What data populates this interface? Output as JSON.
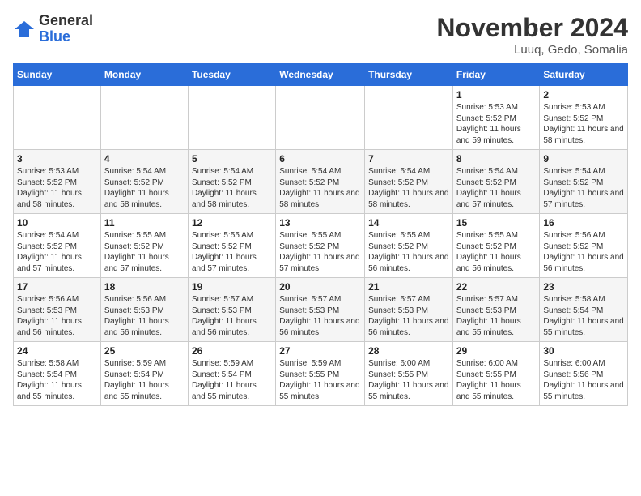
{
  "header": {
    "logo_line1": "General",
    "logo_line2": "Blue",
    "month_title": "November 2024",
    "location": "Luuq, Gedo, Somalia"
  },
  "days_of_week": [
    "Sunday",
    "Monday",
    "Tuesday",
    "Wednesday",
    "Thursday",
    "Friday",
    "Saturday"
  ],
  "weeks": [
    [
      {
        "day": "",
        "info": ""
      },
      {
        "day": "",
        "info": ""
      },
      {
        "day": "",
        "info": ""
      },
      {
        "day": "",
        "info": ""
      },
      {
        "day": "",
        "info": ""
      },
      {
        "day": "1",
        "info": "Sunrise: 5:53 AM\nSunset: 5:52 PM\nDaylight: 11 hours and 59 minutes."
      },
      {
        "day": "2",
        "info": "Sunrise: 5:53 AM\nSunset: 5:52 PM\nDaylight: 11 hours and 58 minutes."
      }
    ],
    [
      {
        "day": "3",
        "info": "Sunrise: 5:53 AM\nSunset: 5:52 PM\nDaylight: 11 hours and 58 minutes."
      },
      {
        "day": "4",
        "info": "Sunrise: 5:54 AM\nSunset: 5:52 PM\nDaylight: 11 hours and 58 minutes."
      },
      {
        "day": "5",
        "info": "Sunrise: 5:54 AM\nSunset: 5:52 PM\nDaylight: 11 hours and 58 minutes."
      },
      {
        "day": "6",
        "info": "Sunrise: 5:54 AM\nSunset: 5:52 PM\nDaylight: 11 hours and 58 minutes."
      },
      {
        "day": "7",
        "info": "Sunrise: 5:54 AM\nSunset: 5:52 PM\nDaylight: 11 hours and 58 minutes."
      },
      {
        "day": "8",
        "info": "Sunrise: 5:54 AM\nSunset: 5:52 PM\nDaylight: 11 hours and 57 minutes."
      },
      {
        "day": "9",
        "info": "Sunrise: 5:54 AM\nSunset: 5:52 PM\nDaylight: 11 hours and 57 minutes."
      }
    ],
    [
      {
        "day": "10",
        "info": "Sunrise: 5:54 AM\nSunset: 5:52 PM\nDaylight: 11 hours and 57 minutes."
      },
      {
        "day": "11",
        "info": "Sunrise: 5:55 AM\nSunset: 5:52 PM\nDaylight: 11 hours and 57 minutes."
      },
      {
        "day": "12",
        "info": "Sunrise: 5:55 AM\nSunset: 5:52 PM\nDaylight: 11 hours and 57 minutes."
      },
      {
        "day": "13",
        "info": "Sunrise: 5:55 AM\nSunset: 5:52 PM\nDaylight: 11 hours and 57 minutes."
      },
      {
        "day": "14",
        "info": "Sunrise: 5:55 AM\nSunset: 5:52 PM\nDaylight: 11 hours and 56 minutes."
      },
      {
        "day": "15",
        "info": "Sunrise: 5:55 AM\nSunset: 5:52 PM\nDaylight: 11 hours and 56 minutes."
      },
      {
        "day": "16",
        "info": "Sunrise: 5:56 AM\nSunset: 5:52 PM\nDaylight: 11 hours and 56 minutes."
      }
    ],
    [
      {
        "day": "17",
        "info": "Sunrise: 5:56 AM\nSunset: 5:53 PM\nDaylight: 11 hours and 56 minutes."
      },
      {
        "day": "18",
        "info": "Sunrise: 5:56 AM\nSunset: 5:53 PM\nDaylight: 11 hours and 56 minutes."
      },
      {
        "day": "19",
        "info": "Sunrise: 5:57 AM\nSunset: 5:53 PM\nDaylight: 11 hours and 56 minutes."
      },
      {
        "day": "20",
        "info": "Sunrise: 5:57 AM\nSunset: 5:53 PM\nDaylight: 11 hours and 56 minutes."
      },
      {
        "day": "21",
        "info": "Sunrise: 5:57 AM\nSunset: 5:53 PM\nDaylight: 11 hours and 56 minutes."
      },
      {
        "day": "22",
        "info": "Sunrise: 5:57 AM\nSunset: 5:53 PM\nDaylight: 11 hours and 55 minutes."
      },
      {
        "day": "23",
        "info": "Sunrise: 5:58 AM\nSunset: 5:54 PM\nDaylight: 11 hours and 55 minutes."
      }
    ],
    [
      {
        "day": "24",
        "info": "Sunrise: 5:58 AM\nSunset: 5:54 PM\nDaylight: 11 hours and 55 minutes."
      },
      {
        "day": "25",
        "info": "Sunrise: 5:59 AM\nSunset: 5:54 PM\nDaylight: 11 hours and 55 minutes."
      },
      {
        "day": "26",
        "info": "Sunrise: 5:59 AM\nSunset: 5:54 PM\nDaylight: 11 hours and 55 minutes."
      },
      {
        "day": "27",
        "info": "Sunrise: 5:59 AM\nSunset: 5:55 PM\nDaylight: 11 hours and 55 minutes."
      },
      {
        "day": "28",
        "info": "Sunrise: 6:00 AM\nSunset: 5:55 PM\nDaylight: 11 hours and 55 minutes."
      },
      {
        "day": "29",
        "info": "Sunrise: 6:00 AM\nSunset: 5:55 PM\nDaylight: 11 hours and 55 minutes."
      },
      {
        "day": "30",
        "info": "Sunrise: 6:00 AM\nSunset: 5:56 PM\nDaylight: 11 hours and 55 minutes."
      }
    ]
  ]
}
